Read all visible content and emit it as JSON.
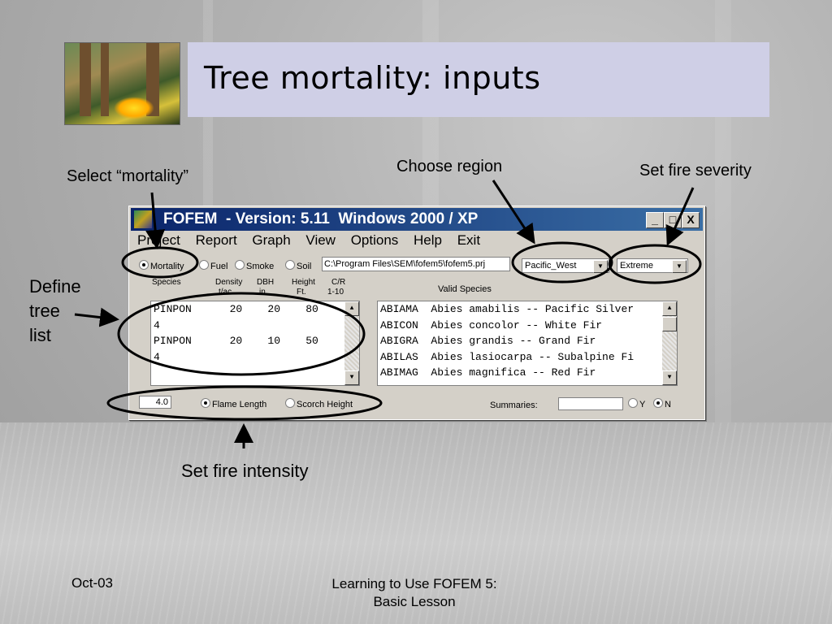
{
  "slide": {
    "title": "Tree mortality: inputs",
    "footer_date": "Oct-03",
    "footer_center_line1": "Learning to Use FOFEM 5:",
    "footer_center_line2": "Basic Lesson"
  },
  "annotations": {
    "select_mortality": "Select “mortality”",
    "choose_region": "Choose region",
    "set_fire_severity": "Set fire severity",
    "define_tree_list_line1": "Define",
    "define_tree_list_line2": "tree",
    "define_tree_list_line3": "list",
    "set_fire_intensity": "Set fire intensity"
  },
  "window": {
    "caption": "FOFEM  - Version: 5.11  Windows 2000 / XP",
    "minimize": "_",
    "maximize": "□",
    "close": "X",
    "menu": [
      "Project",
      "Report",
      "Graph",
      "View",
      "Options",
      "Help",
      "Exit"
    ],
    "modes": [
      {
        "label": "Mortality",
        "selected": true
      },
      {
        "label": "Fuel",
        "selected": false
      },
      {
        "label": "Smoke",
        "selected": false
      },
      {
        "label": "Soil",
        "selected": false
      }
    ],
    "project_path": "C:\\Program Files\\SEM\\fofem5\\fofem5.prj",
    "region": "Pacific_West",
    "severity": "Extreme",
    "tree_headers": {
      "species": "Species",
      "density_l1": "Density",
      "density_l2": "t/ac",
      "dbh_l1": "DBH",
      "dbh_l2": "in.",
      "height_l1": "Height",
      "height_l2": "Ft.",
      "cr_l1": "C/R",
      "cr_l2": "1-10"
    },
    "tree_list": [
      "PINPON      20    20    80",
      "4",
      "PINPON      20    10    50",
      "4"
    ],
    "valid_species_label": "Valid Species",
    "valid_species": [
      "ABIAMA  Abies amabilis -- Pacific Silver",
      "ABICON  Abies concolor -- White Fir",
      "ABIGRA  Abies grandis -- Grand Fir",
      "ABILAS  Abies lasiocarpa -- Subalpine Fi",
      "ABIMAG  Abies magnifica -- Red Fir"
    ],
    "flame_value": "4.0",
    "flame_length_label": "Flame Length",
    "scorch_height_label": "Scorch Height",
    "summaries_label": "Summaries:",
    "yes_label": "Y",
    "no_label": "N"
  }
}
